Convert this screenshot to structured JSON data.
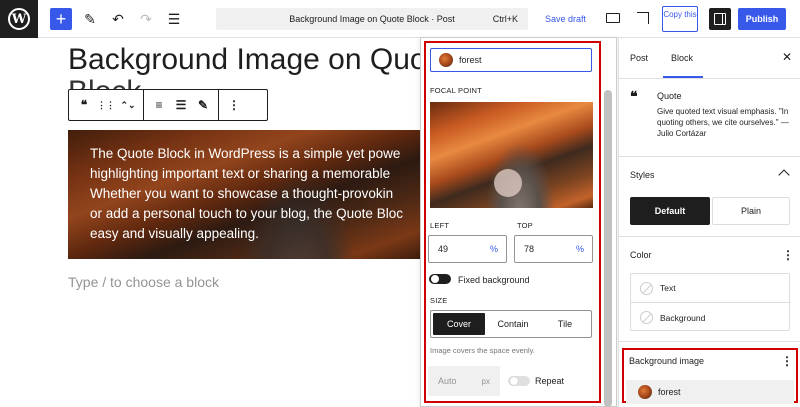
{
  "topbar": {
    "logo": "W",
    "add_icon": "+",
    "pen_icon": "✎",
    "undo_icon": "↶",
    "redo_icon": "↷",
    "list_icon": "☰",
    "doc_title": "Background Image on Quote Block · Post",
    "shortcut": "Ctrl+K",
    "save_draft": "Save draft",
    "copy_label": "Copy this",
    "publish": "Publish"
  },
  "canvas": {
    "post_title": "Background Image on Quote",
    "post_title_overflow": "Block",
    "quote_lines": [
      "The Quote Block in WordPress is a simple yet powe",
      "highlighting important text or sharing a memorable",
      "Whether you want to showcase a thought-provokin",
      "or add a personal touch to your blog, the Quote Bloc",
      "easy and visually appealing."
    ],
    "placeholder": "Type / to choose a block"
  },
  "block_toolbar": {
    "quote_icon": "❝",
    "drag_icon": "⋮⋮",
    "move_icon": "⌃⌄",
    "align_icon": "≡",
    "text_align_icon": "☰",
    "highlight_icon": "✎",
    "more_icon": "⋮"
  },
  "popover": {
    "search_value": "forest",
    "focal_label": "FOCAL POINT",
    "left_label": "LEFT",
    "top_label": "TOP",
    "left_value": "49",
    "top_value": "78",
    "unit": "%",
    "fixed_bg": "Fixed background",
    "size_label": "SIZE",
    "size_options": [
      "Cover",
      "Contain",
      "Tile"
    ],
    "help": "Image covers the space evenly.",
    "auto_value": "Auto",
    "auto_unit": "px",
    "repeat": "Repeat"
  },
  "sidebar": {
    "tab_post": "Post",
    "tab_block": "Block",
    "close": "✕",
    "block_icon": "❝",
    "block_name": "Quote",
    "block_desc": "Give quoted text visual emphasis. \"In quoting others, we cite ourselves.\" — Julio Cortázar",
    "styles_title": "Styles",
    "style_default": "Default",
    "style_plain": "Plain",
    "color_title": "Color",
    "color_text": "Text",
    "color_background": "Background",
    "bg_image_title": "Background image",
    "bg_image_value": "forest",
    "kebab": "⋮"
  },
  "colors": {
    "accent": "#3858e9",
    "highlight": "#d10000",
    "dark": "#1e1e1e"
  }
}
